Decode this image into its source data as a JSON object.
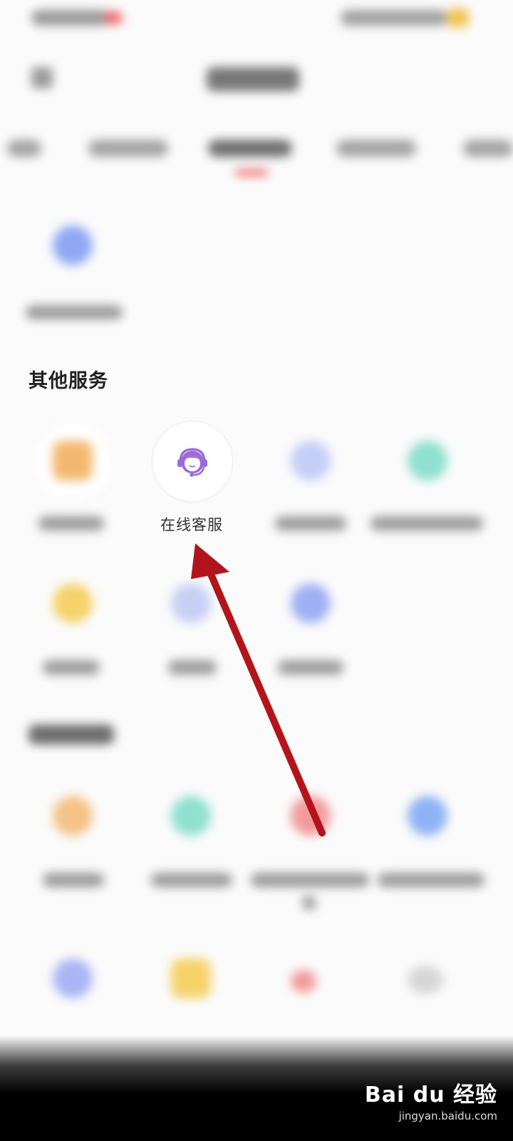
{
  "section": {
    "title": "其他服务"
  },
  "focused_service": {
    "label": "在线客服",
    "icon": "headset-agent-icon",
    "icon_color": "#9b6bd6"
  },
  "annotation": {
    "arrow_color": "#b3141b"
  },
  "watermark": {
    "brand": "Bai du 经验",
    "domain": "jingyan.baidu.com"
  }
}
